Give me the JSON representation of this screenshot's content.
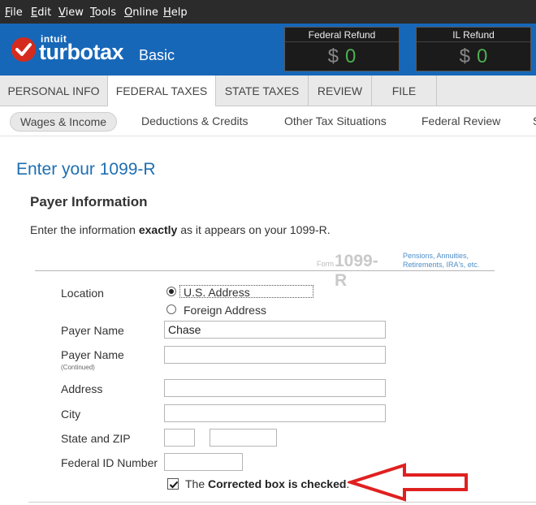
{
  "menu": [
    {
      "hot": "F",
      "rest": "ile"
    },
    {
      "hot": "E",
      "rest": "dit"
    },
    {
      "hot": "V",
      "rest": "iew"
    },
    {
      "hot": "T",
      "rest": "ools"
    },
    {
      "hot": "O",
      "rest": "nline"
    },
    {
      "hot": "H",
      "rest": "elp"
    }
  ],
  "header": {
    "intuit": "intuit",
    "brand": "turbotax",
    "edition": "Basic",
    "federal_refund": {
      "title": "Federal Refund",
      "currency": "$",
      "amount": "0"
    },
    "state_refund": {
      "title": "IL Refund",
      "currency": "$",
      "amount": "0"
    }
  },
  "tabs": [
    "PERSONAL INFO",
    "FEDERAL TAXES",
    "STATE TAXES",
    "REVIEW",
    "FILE"
  ],
  "subnav": [
    "Wages & Income",
    "Deductions & Credits",
    "Other Tax Situations",
    "Federal Review",
    "S"
  ],
  "page": {
    "title": "Enter your 1099-R",
    "section": "Payer Information",
    "instruction_pre": "Enter the information ",
    "instruction_bold": "exactly",
    "instruction_post": " as it appears on your 1099-R."
  },
  "form_mark": {
    "word": "Form",
    "number": "1099-R",
    "desc": "Pensions, Annuities, Retirements, IRA's, etc."
  },
  "form": {
    "location_label": "Location",
    "radio_us": "U.S. Address",
    "radio_foreign": "Foreign Address",
    "payer_name_label": "Payer Name",
    "payer_name_value": "Chase",
    "payer_name2_label": "Payer Name",
    "payer_name2_sub": "(Continued)",
    "payer_name2_value": "",
    "address_label": "Address",
    "address_value": "",
    "city_label": "City",
    "city_value": "",
    "state_zip_label": "State and ZIP",
    "state_value": "",
    "zip_value": "",
    "fed_id_label": "Federal ID Number",
    "fed_id_value": "",
    "corrected_pre": "The ",
    "corrected_bold": "Corrected box is checked",
    "corrected_post": ".",
    "corrected_checked": true
  },
  "colors": {
    "accent": "#1767b8",
    "arrow": "#e02020",
    "refund_amount": "#4caf50"
  }
}
